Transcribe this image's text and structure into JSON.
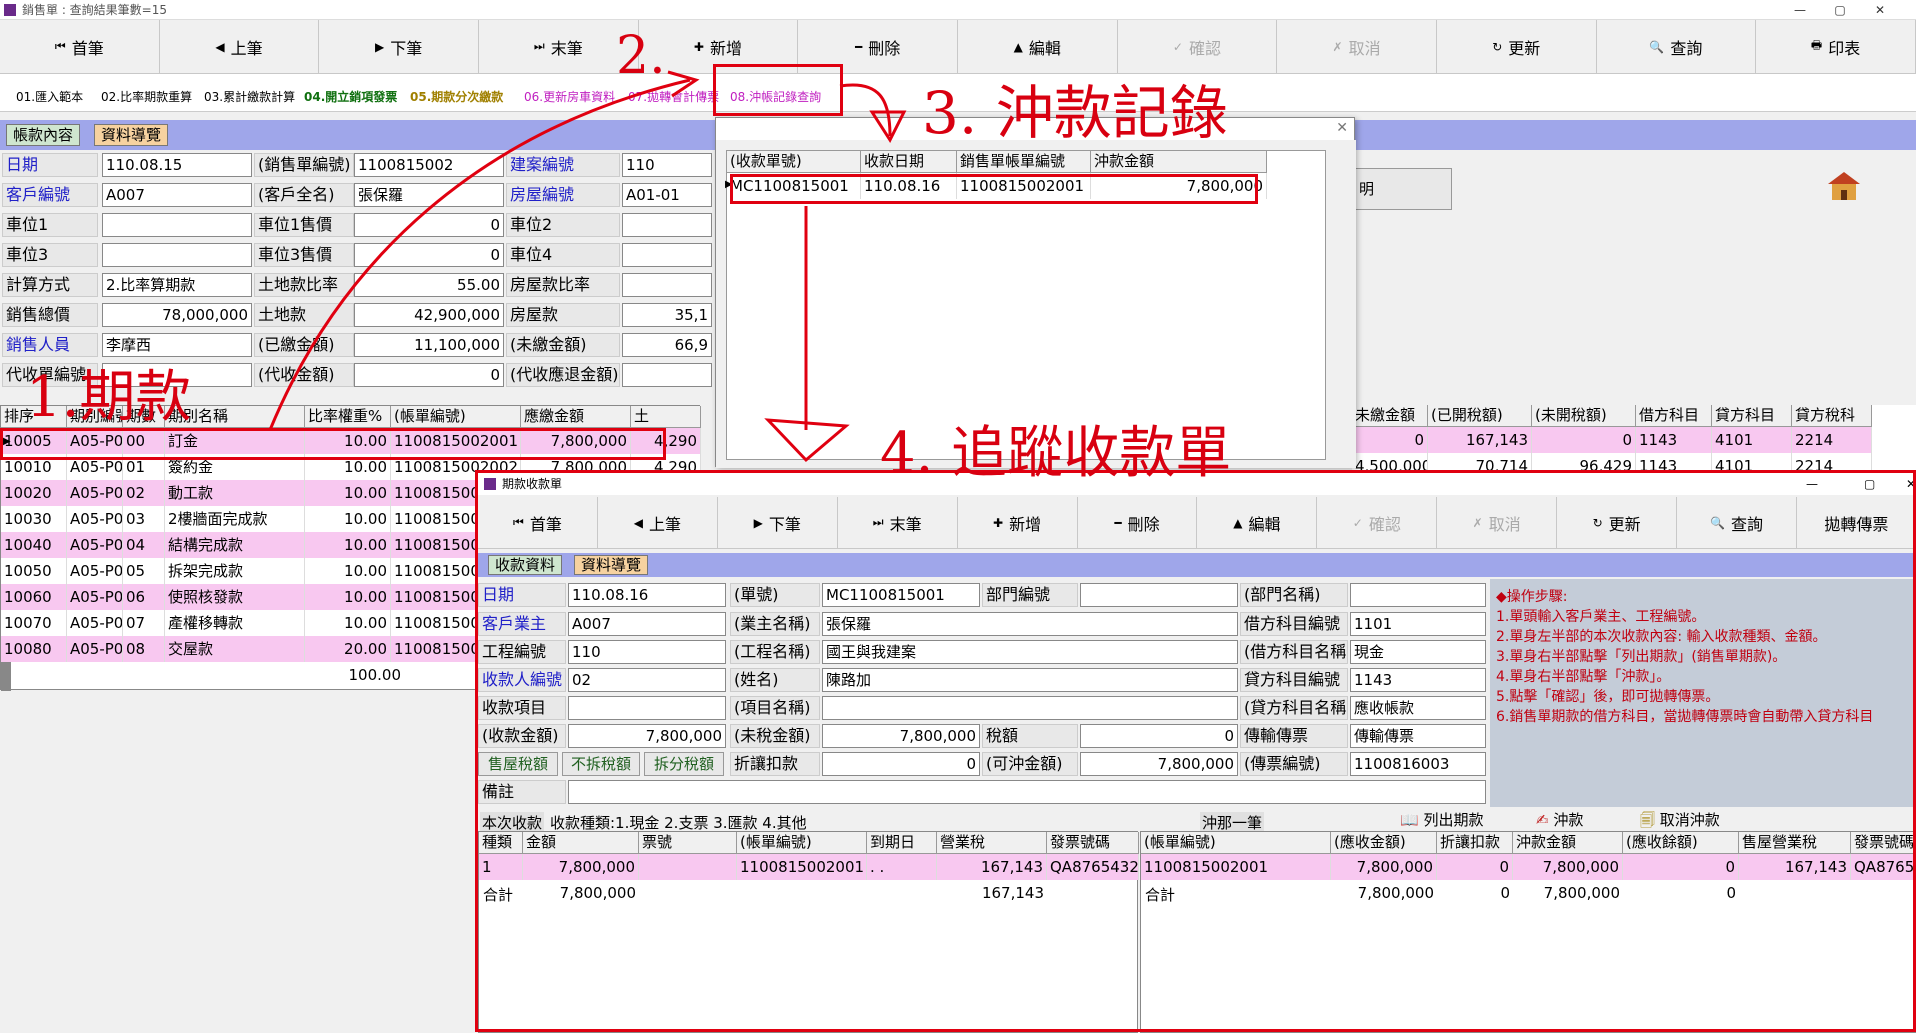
{
  "main_window": {
    "title": "銷售單 : 查詢結果筆數=15",
    "toolbar": [
      {
        "label": "首筆",
        "icon": "⏮"
      },
      {
        "label": "上筆",
        "icon": "◀"
      },
      {
        "label": "下筆",
        "icon": "▶"
      },
      {
        "label": "末筆",
        "icon": "⏭"
      },
      {
        "label": "新增",
        "icon": "✚"
      },
      {
        "label": "刪除",
        "icon": "━"
      },
      {
        "label": "編輯",
        "icon": "▲"
      },
      {
        "label": "確認",
        "icon": "✓"
      },
      {
        "label": "取消",
        "icon": "✗"
      },
      {
        "label": "更新",
        "icon": "↻"
      },
      {
        "label": "查詢",
        "icon": "🔍"
      },
      {
        "label": "印表",
        "icon": "🖶"
      }
    ],
    "sub_tabs": [
      "01.匯入範本",
      "02.比率期款重算",
      "03.累計繳款計算",
      "04.開立銷項發票",
      "05.期款分次繳款",
      "06.更新房車資料",
      "07.拋轉會計傳票",
      "08.沖帳記錄查詢"
    ],
    "panel_tabs": [
      "帳款內容",
      "資料導覽"
    ],
    "fields": {
      "date_label": "日期",
      "date": "110.08.15",
      "sales_no_label": "(銷售單編號)",
      "sales_no": "1100815002",
      "project_no_label": "建案編號",
      "project_no": "110",
      "customer_label": "客戶編號",
      "customer_no": "A007",
      "customer_name_label": "(客戶全名)",
      "customer_name": "張保羅",
      "house_no_label": "房屋編號",
      "house_no": "A01-01",
      "parking1_label": "車位1",
      "parking1_price_label": "車位1售價",
      "parking1_price": "0",
      "parking2_label": "車位2",
      "parking3_label": "車位3",
      "parking3_price_label": "車位3售價",
      "parking3_price": "0",
      "parking4_label": "車位4",
      "calc_label": "計算方式",
      "calc": "2.比率算期款",
      "land_ratio_label": "土地款比率",
      "land_ratio": "55.00",
      "house_ratio_label": "房屋款比率",
      "total_label": "銷售總價",
      "total": "78,000,000",
      "land_amt_label": "土地款",
      "land_amt": "42,900,000",
      "house_amt_label": "房屋款",
      "house_amt": "35,1",
      "sales_person_label": "銷售人員",
      "sales_person": "李摩西",
      "paid_label": "(已繳金額)",
      "paid": "11,100,000",
      "unpaid_label": "(未繳金額)",
      "unpaid": "66,9",
      "agent_no_label": "代收單編號",
      "agent_amt_label": "(代收金額)",
      "agent_amt": "0",
      "agent_refund_label": "(代收應退金額)"
    },
    "side_button": "明",
    "grid_headers": [
      "排序",
      "期別編號",
      "期數",
      "期別名稱",
      "比率權重%",
      "(帳單編號)",
      "應繳金額",
      "土"
    ],
    "grid_rows": [
      [
        "10005",
        "A05-P00",
        "00",
        "訂金",
        "10.00",
        "1100815002001",
        "7,800,000",
        "4,290"
      ],
      [
        "10010",
        "A05-P01",
        "01",
        "簽約金",
        "10.00",
        "1100815002002",
        "7,800,000",
        "4,290"
      ],
      [
        "10020",
        "A05-P02",
        "02",
        "動工款",
        "10.00",
        "110081500",
        "",
        ""
      ],
      [
        "10030",
        "A05-P03",
        "03",
        "2樓牆面完成款",
        "10.00",
        "110081500",
        "",
        ""
      ],
      [
        "10040",
        "A05-P04",
        "04",
        "結構完成款",
        "10.00",
        "110081500",
        "",
        ""
      ],
      [
        "10050",
        "A05-P05",
        "05",
        "拆架完成款",
        "10.00",
        "110081500",
        "",
        ""
      ],
      [
        "10060",
        "A05-P06",
        "06",
        "使照核發款",
        "10.00",
        "110081500",
        "",
        ""
      ],
      [
        "10070",
        "A05-P07",
        "07",
        "產權移轉款",
        "10.00",
        "110081500",
        "",
        ""
      ],
      [
        "10080",
        "A05-P08",
        "08",
        "交屋款",
        "20.00",
        "110081500",
        "",
        ""
      ]
    ],
    "grid_total": "100.00",
    "right_headers": [
      "未繳金額",
      "(已開稅額)",
      "(未開稅額)",
      "借方科目",
      "貸方科目",
      "貸方稅科"
    ],
    "right_rows": [
      [
        "0",
        "167,143",
        "0",
        "1143",
        "4101",
        "2214"
      ],
      [
        "4,500,000",
        "70,714",
        "96,429",
        "1143",
        "4101",
        "2214"
      ]
    ]
  },
  "popup": {
    "headers": [
      "(收款單號)",
      "收款日期",
      "銷售單帳單編號",
      "沖款金額"
    ],
    "row": [
      "MC1100815001",
      "110.08.16",
      "1100815002001",
      "7,800,000"
    ]
  },
  "annotations": {
    "a1": "1.期款",
    "a2": "2.",
    "a3": "3. 沖款記錄",
    "a4": "4. 追蹤收款單"
  },
  "receipt_window": {
    "title": "期款收款單",
    "toolbar": [
      {
        "label": "首筆",
        "icon": "⏮"
      },
      {
        "label": "上筆",
        "icon": "◀"
      },
      {
        "label": "下筆",
        "icon": "▶"
      },
      {
        "label": "末筆",
        "icon": "⏭"
      },
      {
        "label": "新增",
        "icon": "✚"
      },
      {
        "label": "刪除",
        "icon": "━"
      },
      {
        "label": "編輯",
        "icon": "▲"
      },
      {
        "label": "確認",
        "icon": "✓"
      },
      {
        "label": "取消",
        "icon": "✗"
      },
      {
        "label": "更新",
        "icon": "↻"
      },
      {
        "label": "查詢",
        "icon": "🔍"
      },
      {
        "label": "拋轉傳票",
        "icon": ""
      }
    ],
    "panel_tabs": [
      "收款資料",
      "資料導覽"
    ],
    "fields": {
      "date_label": "日期",
      "date": "110.08.16",
      "no_label": "(單號)",
      "no": "MC1100815001",
      "dept_label": "部門編號",
      "dept_name_label": "(部門名稱)",
      "owner_label": "客戶業主",
      "owner": "A007",
      "owner_name_label": "(業主名稱)",
      "owner_name": "張保羅",
      "debit_label": "借方科目編號",
      "debit": "1101",
      "proj_label": "工程編號",
      "proj": "110",
      "proj_name_label": "(工程名稱)",
      "proj_name": "國王與我建案",
      "debit_name_label": "(借方科目名稱)",
      "debit_name": "現金",
      "collector_label": "收款人編號",
      "collector": "02",
      "collector_name_label": "(姓名)",
      "collector_name": "陳路加",
      "credit_label": "貸方科目編號",
      "credit": "1143",
      "item_label": "收款項目",
      "item_name_label": "(項目名稱)",
      "credit_name_label": "(貸方科目名稱)",
      "credit_name": "應收帳款",
      "amt_label": "(收款金額)",
      "amt": "7,800,000",
      "pretax_label": "(未稅金額)",
      "pretax": "7,800,000",
      "tax_label": "稅額",
      "tax": "0",
      "voucher_label": "傳輸傳票",
      "voucher": "傳輸傳票",
      "btn_sell_tax": "售屋稅額",
      "btn_no_split": "不拆稅額",
      "btn_split": "拆分稅額",
      "discount_label": "折讓扣款",
      "discount": "0",
      "offset_label": "(可沖金額)",
      "offset": "7,800,000",
      "voucher_no_label": "(傳票編號)",
      "voucher_no": "1100816003",
      "memo_label": "備註"
    },
    "steps": [
      "◆操作步驟:",
      "1.單頭輸入客戶業主、工程編號。",
      "2.單身左半部的本次收款內容: 輸入收款種類、金額。",
      "3.單身右半部點擊「列出期款」(銷售單期款)。",
      "4.單身右半部點擊「沖款」。",
      "5.點擊「確認」後，即可拋轉傳票。",
      "6.銷售單期款的借方科目，當拋轉傳票時會自動帶入貸方科目"
    ],
    "left_caption": "本次收款",
    "left_caption2": "收款種類:1.現金 2.支票 3.匯款 4.其他",
    "left_headers": [
      "種類",
      "金額",
      "票號",
      "(帳單編號)",
      "到期日",
      "營業稅",
      "發票號碼"
    ],
    "left_row": [
      "1",
      "7,800,000",
      "",
      "1100815002001",
      ". .",
      "167,143",
      "QA8765432"
    ],
    "left_total_label": "合計",
    "left_total_amt": "7,800,000",
    "left_total_tax": "167,143",
    "right_caption": "沖那一筆",
    "btn_list": "列出期款",
    "btn_offset": "沖款",
    "btn_cancel": "取消沖款",
    "right_headers": [
      "(帳單編號)",
      "(應收金額)",
      "折讓扣款",
      "沖款金額",
      "(應收餘額)",
      "售屋營業稅",
      "發票號碼"
    ],
    "right_row": [
      "1100815002001",
      "7,800,000",
      "0",
      "7,800,000",
      "0",
      "167,143",
      "QA8765"
    ],
    "right_total_label": "合計",
    "right_total": [
      "7,800,000",
      "0",
      "7,800,000",
      "0"
    ]
  }
}
